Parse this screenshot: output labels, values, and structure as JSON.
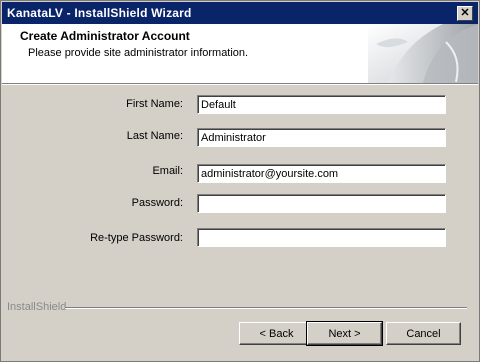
{
  "window": {
    "title": "KanataLV - InstallShield Wizard",
    "close_glyph": "✕"
  },
  "header": {
    "title": "Create Administrator Account",
    "subtitle": "Please provide site administrator information."
  },
  "form": {
    "first_name": {
      "label": "First Name:",
      "value": "Default"
    },
    "last_name": {
      "label": "Last Name:",
      "value": "Administrator"
    },
    "email": {
      "label": "Email:",
      "value": "administrator@yoursite.com"
    },
    "password": {
      "label": "Password:",
      "value": ""
    },
    "retype_password": {
      "label": "Re-type Password:",
      "value": ""
    }
  },
  "footer": {
    "brand": "InstallShield",
    "back_label": "< Back",
    "next_label": "Next >",
    "cancel_label": "Cancel"
  },
  "colors": {
    "titlebar": "#0a246a",
    "dialog_bg": "#d4d0c8"
  }
}
